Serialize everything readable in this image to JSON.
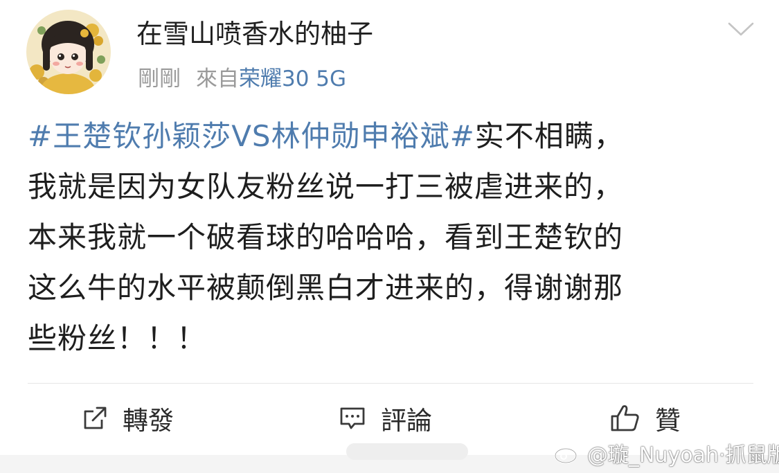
{
  "user": {
    "name": "在雪山喷香水的柚子",
    "time": "剛剛",
    "source_prefix": "來自",
    "device": "荣耀30 5G"
  },
  "post": {
    "lines": [
      [
        {
          "text": "#王楚钦孙颖莎VS林仲勋申裕斌#",
          "hashtag": true
        },
        {
          "text": "实不相瞒，",
          "hashtag": false
        }
      ],
      [
        {
          "text": "我就是因为女队友粉丝说一打三被虐进来的，",
          "hashtag": false
        }
      ],
      [
        {
          "text": "本来我就一个破看球的哈哈哈，看到王楚钦的",
          "hashtag": false
        }
      ],
      [
        {
          "text": "这么牛的水平被颠倒黑白才进来的，得谢谢那",
          "hashtag": false
        }
      ],
      [
        {
          "text": "些粉丝！！！",
          "hashtag": false
        }
      ]
    ]
  },
  "actions": {
    "repost": "轉發",
    "comment": "評論",
    "like": "贊"
  },
  "watermark": "@璇_Nuyoah·抓鼠版",
  "colors": {
    "link": "#4f7cae",
    "meta": "#9a9a9a",
    "text": "#1e1e1e"
  },
  "icons": {
    "chevron": "chevron-down-icon",
    "repost": "repost-icon",
    "comment": "comment-icon",
    "like": "thumbs-up-icon",
    "weibo": "weibo-logo-icon"
  }
}
